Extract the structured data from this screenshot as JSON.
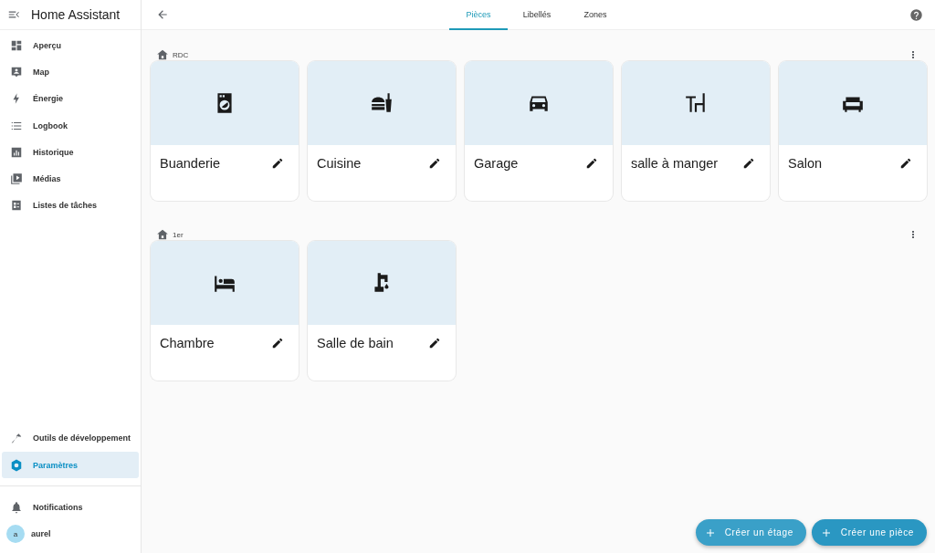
{
  "sidebar": {
    "title": "Home Assistant",
    "items": [
      {
        "label": "Aperçu",
        "selected": false
      },
      {
        "label": "Map",
        "selected": false
      },
      {
        "label": "Énergie",
        "selected": false
      },
      {
        "label": "Logbook",
        "selected": false
      },
      {
        "label": "Historique",
        "selected": false
      },
      {
        "label": "Médias",
        "selected": false
      },
      {
        "label": "Listes de tâches",
        "selected": false
      }
    ],
    "bottom_items": [
      {
        "label": "Outils de développement",
        "selected": false
      },
      {
        "label": "Paramètres",
        "selected": true
      }
    ],
    "notifications": "Notifications",
    "user": {
      "initial": "a",
      "name": "aurel"
    }
  },
  "tabs": [
    {
      "label": "Pièces",
      "selected": true
    },
    {
      "label": "Libellés",
      "selected": false
    },
    {
      "label": "Zones",
      "selected": false
    }
  ],
  "floors": [
    {
      "name": "RDC",
      "areas": [
        {
          "name": "Buanderie"
        },
        {
          "name": "Cuisine"
        },
        {
          "name": "Garage"
        },
        {
          "name": "salle à manger"
        },
        {
          "name": "Salon"
        }
      ]
    },
    {
      "name": "1er",
      "areas": [
        {
          "name": "Chambre"
        },
        {
          "name": "Salle de bain"
        }
      ]
    }
  ],
  "buttons": [
    "Créer un étage",
    "Créer une pièce"
  ]
}
